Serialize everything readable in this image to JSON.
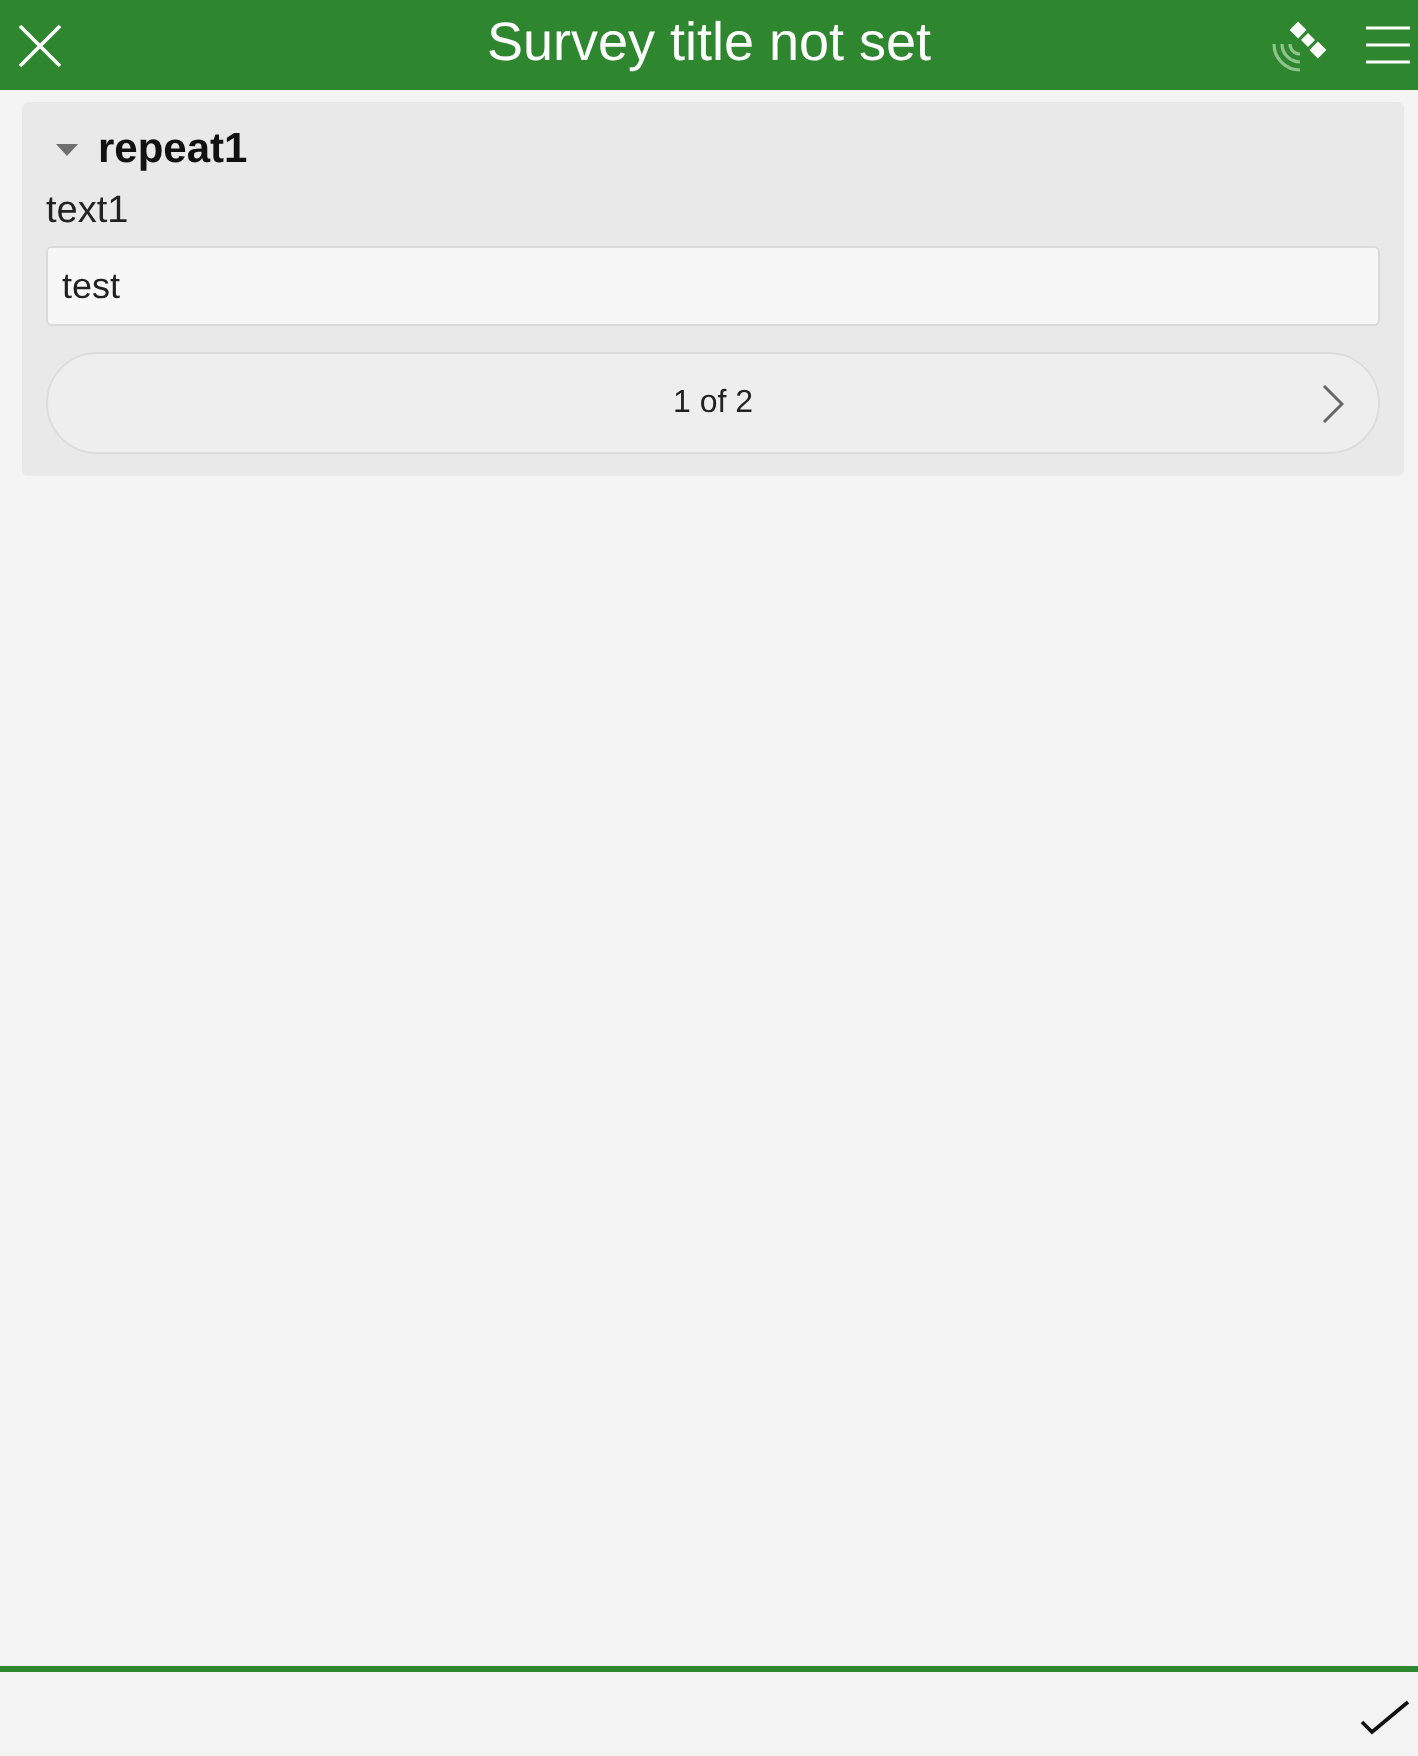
{
  "header": {
    "title": "Survey title not set"
  },
  "group": {
    "label": "repeat1",
    "expanded": true,
    "fields": [
      {
        "label": "text1",
        "value": "test"
      }
    ],
    "pager": {
      "text": "1 of 2"
    }
  }
}
